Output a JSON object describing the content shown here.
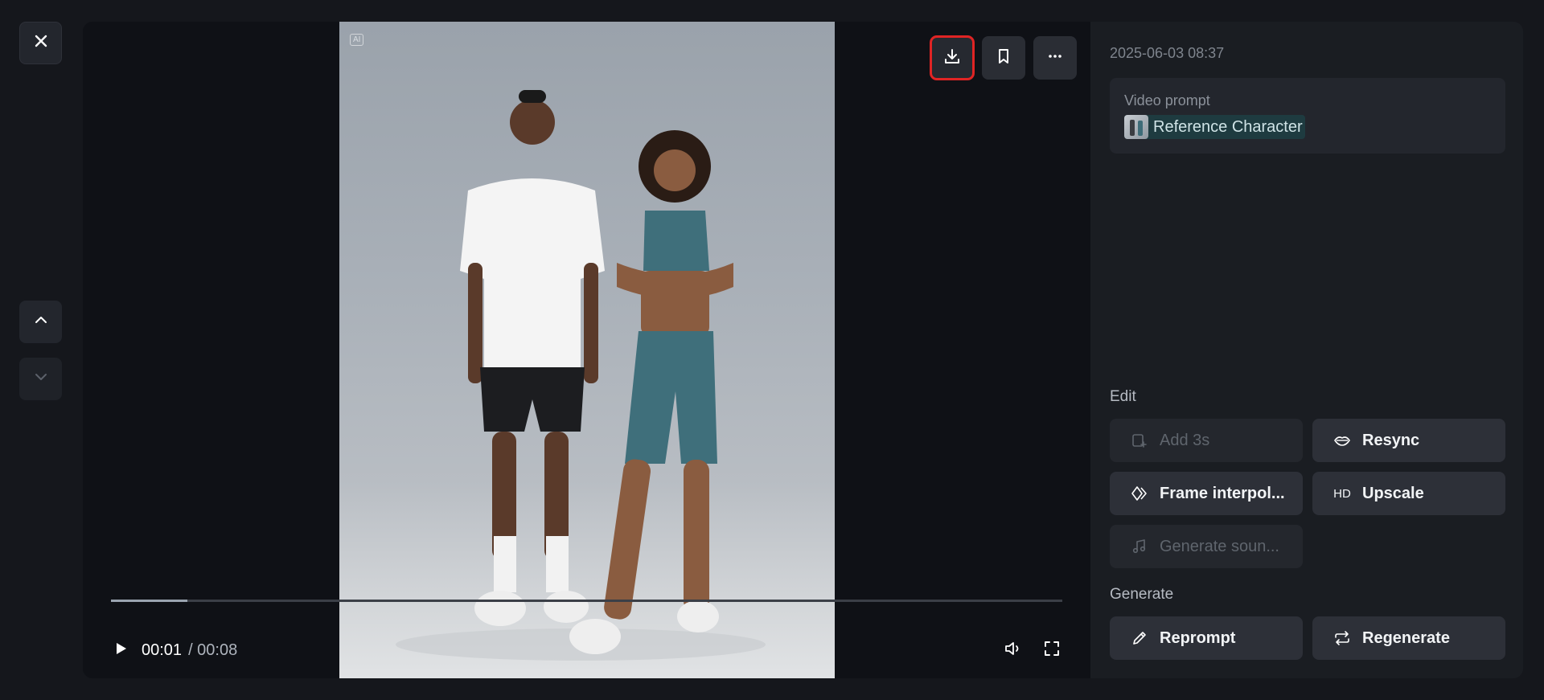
{
  "viewer": {
    "ai_tag": "AI",
    "time_current": "00:01",
    "time_total": "/ 00:08",
    "progress": 0.08
  },
  "panel": {
    "date": "2025-06-03 08:37",
    "prompt_title": "Video prompt",
    "reference_label": "Reference Character",
    "edit_label": "Edit",
    "generate_label": "Generate",
    "buttons": {
      "add3s": "Add 3s",
      "resync": "Resync",
      "frame_interp": "Frame interpol...",
      "upscale": "Upscale",
      "upscale_icon_text": "HD",
      "generate_sound": "Generate soun...",
      "reprompt": "Reprompt",
      "regenerate": "Regenerate"
    }
  },
  "icons": {
    "close": "close-icon",
    "up": "chevron-up-icon",
    "down": "chevron-down-icon",
    "download": "download-icon",
    "bookmark": "bookmark-icon",
    "more": "more-icon",
    "play": "play-icon",
    "volume": "volume-icon",
    "fullscreen": "fullscreen-icon"
  },
  "colors": {
    "highlight": "#e02424",
    "reference_chip": "#1e3b40"
  }
}
